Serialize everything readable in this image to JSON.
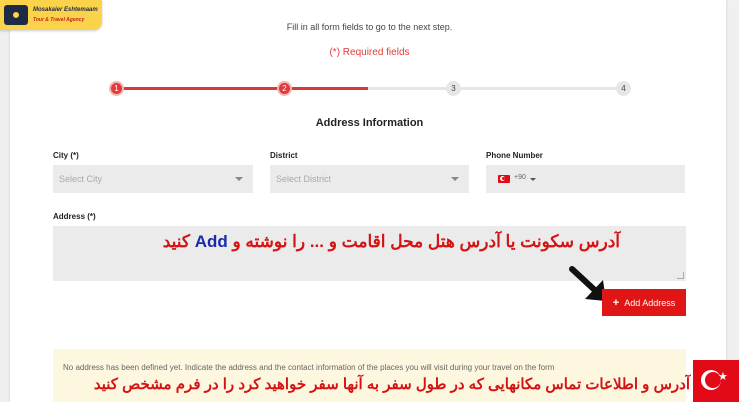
{
  "brand": {
    "name": "Mosakaier Eshtemaam",
    "tagline": "Tour & Travel Agency"
  },
  "form": {
    "instruction": "Fill in all form fields to go to the next step.",
    "required_note": "(*) Required fields",
    "steps": [
      "1",
      "2",
      "3",
      "4"
    ],
    "current_step": 2,
    "section_title": "Address Information",
    "city": {
      "label": "City (*)",
      "placeholder": "Select City"
    },
    "district": {
      "label": "District",
      "placeholder": "Select District"
    },
    "phone": {
      "label": "Phone Number",
      "dial_code": "+90"
    },
    "address": {
      "label": "Address (*)"
    },
    "add_button": "Add Address",
    "notice": "No address has been defined yet. Indicate the address and the contact information of the places you will visit during your travel on the form"
  },
  "overlays": {
    "line1_before": "آدرس سکونت یا آدرس هتل محل اقامت و ... را نوشته و",
    "line1_en": "Add",
    "line1_after": "کنید",
    "line2": "آدرس و اطلاعات تماس مکانهایی که در طول سفر به آنها سفر خواهید کرد را در فرم مشخص کنید"
  },
  "colors": {
    "accent": "#e01515",
    "required": "#e23a3a",
    "notice_bg": "#fdf7e0",
    "brand_bg": "#fbd34b"
  }
}
